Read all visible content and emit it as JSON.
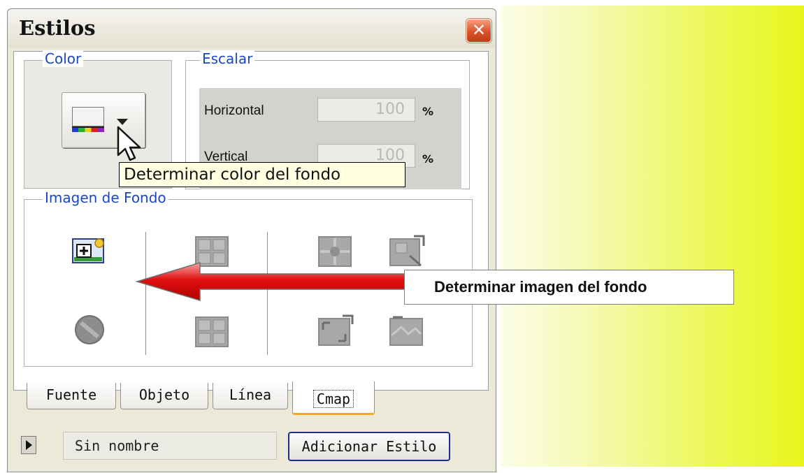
{
  "window": {
    "title": "Estilos",
    "close_label": "✕"
  },
  "color_group": {
    "legend": "Color",
    "tooltip": "Determinar color del fondo"
  },
  "scale_group": {
    "legend": "Escalar",
    "horizontal_label": "Horizontal",
    "horizontal_value": "100",
    "vertical_label": "Vertical",
    "vertical_value": "100",
    "unit": "%"
  },
  "image_group": {
    "legend": "Imagen de Fondo"
  },
  "callout": {
    "text": "Determinar imagen del fondo"
  },
  "tabs": [
    {
      "label": "Fuente"
    },
    {
      "label": "Objeto"
    },
    {
      "label": "Línea"
    },
    {
      "label": "Cmap"
    }
  ],
  "footer": {
    "style_name": "Sin nombre",
    "add_style_label": "Adicionar Estilo"
  },
  "colors": {
    "accent_legend": "#1b46c4",
    "callout_arrow": "#e01010",
    "backdrop": "#e6f61b",
    "tooltip_bg": "#ffffe1"
  }
}
